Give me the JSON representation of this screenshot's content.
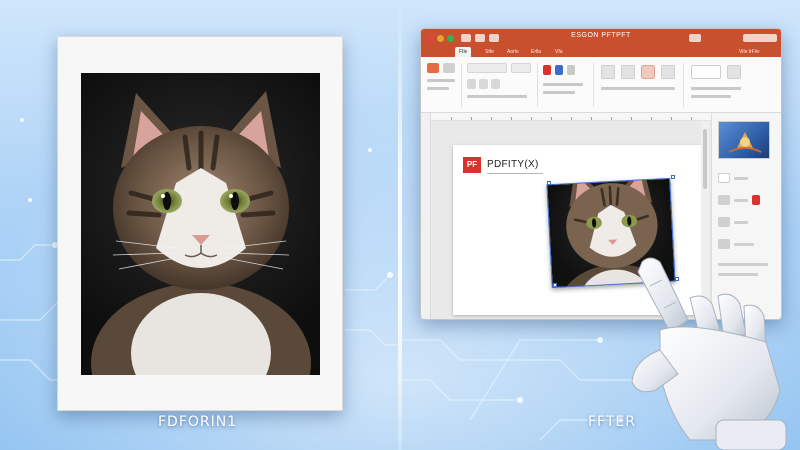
{
  "captions": {
    "before": "FDFORIN1",
    "after": "FFTER"
  },
  "app_window": {
    "title": "ESGON PFTPFT",
    "tabs": [
      "FIle",
      "Stfe",
      "Aorlo",
      "Erlla",
      "Vfa"
    ],
    "right_tab": "ViIe lrFiiv",
    "traffic_lights": [
      "#e0443e",
      "#e0a72a",
      "#38b24b"
    ],
    "accent_color": "#c9502e"
  },
  "document": {
    "logo_text": "PF",
    "heading": "PDFITY(X)"
  },
  "colors": {
    "pdf_red": "#d8332a",
    "selection_blue": "#3a6bd0"
  },
  "icons": {
    "pointer_hand": "robot-hand-icon"
  }
}
